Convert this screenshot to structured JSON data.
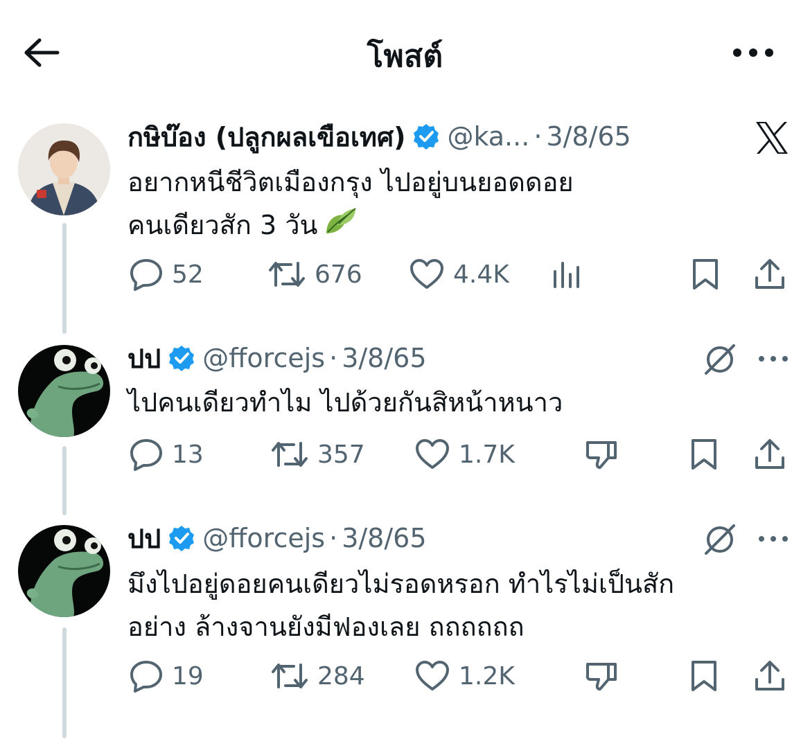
{
  "header": {
    "title": "โพสต์",
    "back_icon": "arrow-left-icon",
    "more_icon": "more-horizontal-icon"
  },
  "colors": {
    "verified": "#1d9bf0",
    "muted": "#536471",
    "text": "#0f1419",
    "thread_line": "#cfd9de"
  },
  "posts": [
    {
      "name": "กษิบ๊อง (ปลูกผลเขือเทศ)",
      "handle": "@ka...",
      "dot": "·",
      "date": "3/8/65",
      "lines": [
        "อยากหนีชีวิตเมืองกรุง ไปอยู่บนยอดดอย",
        "คนเดียวสัก 3 วัน"
      ],
      "emoji": "leaf-icon",
      "replies": "52",
      "reposts": "676",
      "likes": "4.4K",
      "corner_icon": "x-logo-icon"
    },
    {
      "name": "ปป",
      "handle": "@fforcejs",
      "dot": "·",
      "date": "3/8/65",
      "lines": [
        "ไปคนเดียวทำไม ไปด้วยกันสิหน้าหนาว"
      ],
      "replies": "13",
      "reposts": "357",
      "likes": "1.7K",
      "corner_icon": "grok-icon"
    },
    {
      "name": "ปป",
      "handle": "@fforcejs",
      "dot": "·",
      "date": "3/8/65",
      "lines": [
        "มึงไปอยู่ดอยคนเดียวไม่รอดหรอก ทำไรไม่เป็นสัก",
        "อย่าง ล้างจานยังมีฟองเลย ถถถถถถ"
      ],
      "replies": "19",
      "reposts": "284",
      "likes": "1.2K",
      "corner_icon": "grok-icon"
    }
  ]
}
